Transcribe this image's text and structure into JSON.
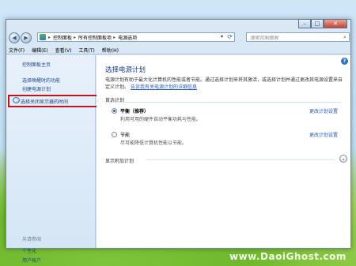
{
  "window": {
    "caption": {
      "minimize": "–",
      "maximize": "□",
      "close": "✕"
    }
  },
  "toolbar": {
    "back": "◀",
    "forward": "▶",
    "breadcrumbs": [
      "控制面板",
      "所有控制面板项",
      "电源选项"
    ],
    "separator": "▸",
    "dropdown": "▾",
    "refresh": "⟳",
    "search_placeholder": "搜索控制面板",
    "search_icon": "⌕"
  },
  "menu": {
    "items": [
      "文件(F)",
      "编辑(E)",
      "查看(V)",
      "工具(T)",
      "帮助(H)"
    ]
  },
  "sidebar": {
    "home": "控制面板主页",
    "wake_password": "选择唤醒时的功能",
    "create_plan": "创建电源计划",
    "display_off": "选择关闭显示器的时间",
    "see_also": "另请参阅",
    "personalization": "个性化",
    "user_accounts": "用户帐户"
  },
  "content": {
    "help": "?",
    "title": "选择电源计划",
    "description": "电源计划有助于最大化计算机的性能或者节能。通过选择计划来将其激活，或选择计划并通过更改其电源设置来自定义计划。",
    "description_link": "告诉我有关电源计划的详细信息",
    "section_label": "首选计划",
    "plans": [
      {
        "name": "平衡（推荐）",
        "desc": "利用可用的硬件自动平衡功耗与性能。",
        "link": "更改计划设置",
        "selected": true
      },
      {
        "name": "节能",
        "desc": "尽可能降低计算机性能以节能。",
        "link": "更改计划设置",
        "selected": false
      }
    ],
    "show_more": "显示附加计划",
    "expand_icon": "⌄"
  },
  "watermark": "www.DaoiGhost.com"
}
